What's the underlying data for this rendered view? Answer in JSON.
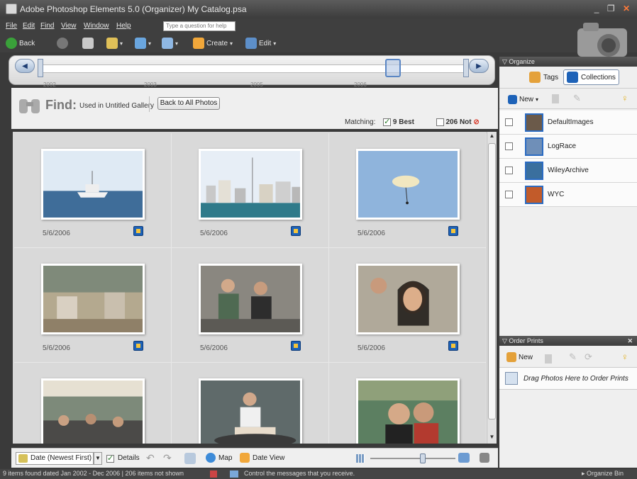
{
  "window": {
    "title": "Adobe Photoshop Elements 5.0 (Organizer)   My Catalog.psa"
  },
  "menubar": {
    "items": [
      "File",
      "Edit",
      "Find",
      "View",
      "Window",
      "Help"
    ],
    "help_placeholder": "Type a question for help"
  },
  "toolbar": {
    "back_label": "Back",
    "create_label": "Create",
    "edit_label": "Edit"
  },
  "timeline": {
    "years": [
      "2002",
      "2003",
      "2005",
      "2006"
    ]
  },
  "findbar": {
    "find_label": "Find:",
    "criteria": "Used in Untitled Gallery",
    "back_to_all": "Back to All Photos",
    "matching_label": "Matching:",
    "best_label": "9 Best",
    "best_checked": true,
    "not_label": "206 Not",
    "not_checked": false
  },
  "photos": [
    {
      "date": "5/6/2006",
      "scene": "boat"
    },
    {
      "date": "5/6/2006",
      "scene": "city"
    },
    {
      "date": "5/6/2006",
      "scene": "parasail"
    },
    {
      "date": "5/6/2006",
      "scene": "patio"
    },
    {
      "date": "5/6/2006",
      "scene": "group"
    },
    {
      "date": "5/6/2006",
      "scene": "woman"
    },
    {
      "date": "",
      "scene": "crowd"
    },
    {
      "date": "",
      "scene": "cake"
    },
    {
      "date": "",
      "scene": "couple"
    }
  ],
  "bottombar": {
    "sort_label": "Date (Newest First)",
    "details_label": "Details",
    "details_checked": true,
    "map_label": "Map",
    "dateview_label": "Date View",
    "zoom_level": 0.62
  },
  "statusbar": {
    "left_text": "9 items found dated Jan 2002 - Dec 2006  |  206 items not shown",
    "message_text": "Control the messages that you receive.",
    "organize_bin": "Organize Bin"
  },
  "organize": {
    "title": "Organize",
    "tags_label": "Tags",
    "collections_label": "Collections",
    "new_label": "New",
    "collections": [
      "DefaultImages",
      "LogRace",
      "WileyArchive",
      "WYC"
    ]
  },
  "order_prints": {
    "title": "Order Prints",
    "new_label": "New",
    "drag_hint": "Drag Photos Here to Order Prints"
  },
  "colors": {
    "chrome_dark": "#3f3f3f",
    "panel_light": "#efefef",
    "grid_bg": "#d9d9d9",
    "accent_blue": "#1d62b8"
  }
}
